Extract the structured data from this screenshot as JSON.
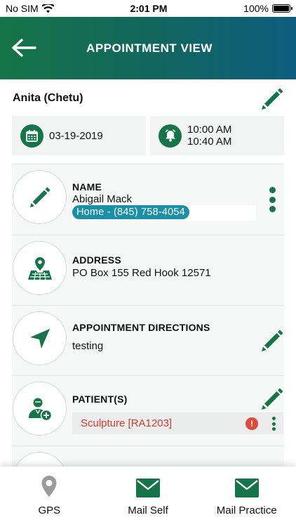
{
  "status_bar": {
    "carrier": "No SIM",
    "time": "2:01 PM",
    "battery": "100%"
  },
  "header": {
    "title": "APPOINTMENT VIEW"
  },
  "owner": {
    "name": "Anita (Chetu)"
  },
  "schedule": {
    "date": "03-19-2019",
    "start_time": "10:00 AM",
    "end_time": "10:40 AM"
  },
  "contact": {
    "label": "NAME",
    "name": "Abigail Mack",
    "phone": "Home - (845) 758-4054"
  },
  "address": {
    "label": "ADDRESS",
    "value": "PO Box 155  Red Hook 12571"
  },
  "directions": {
    "label": "APPOINTMENT DIRECTIONS",
    "value": "testing"
  },
  "patients": {
    "label": "PATIENT(S)",
    "items": [
      {
        "name": "Sculpture [RA1203]",
        "warning_symbol": "!"
      }
    ]
  },
  "tabs": [
    {
      "label": "GPS",
      "icon": "map-pin-icon"
    },
    {
      "label": "Mail Self",
      "icon": "mail-icon"
    },
    {
      "label": "Mail Practice",
      "icon": "mail-icon"
    }
  ],
  "colors": {
    "brand_green": "#157448",
    "header_teal": "#0c5e7e",
    "phone_pill": "#1a8fa8",
    "alert_red": "#d93a2b"
  }
}
